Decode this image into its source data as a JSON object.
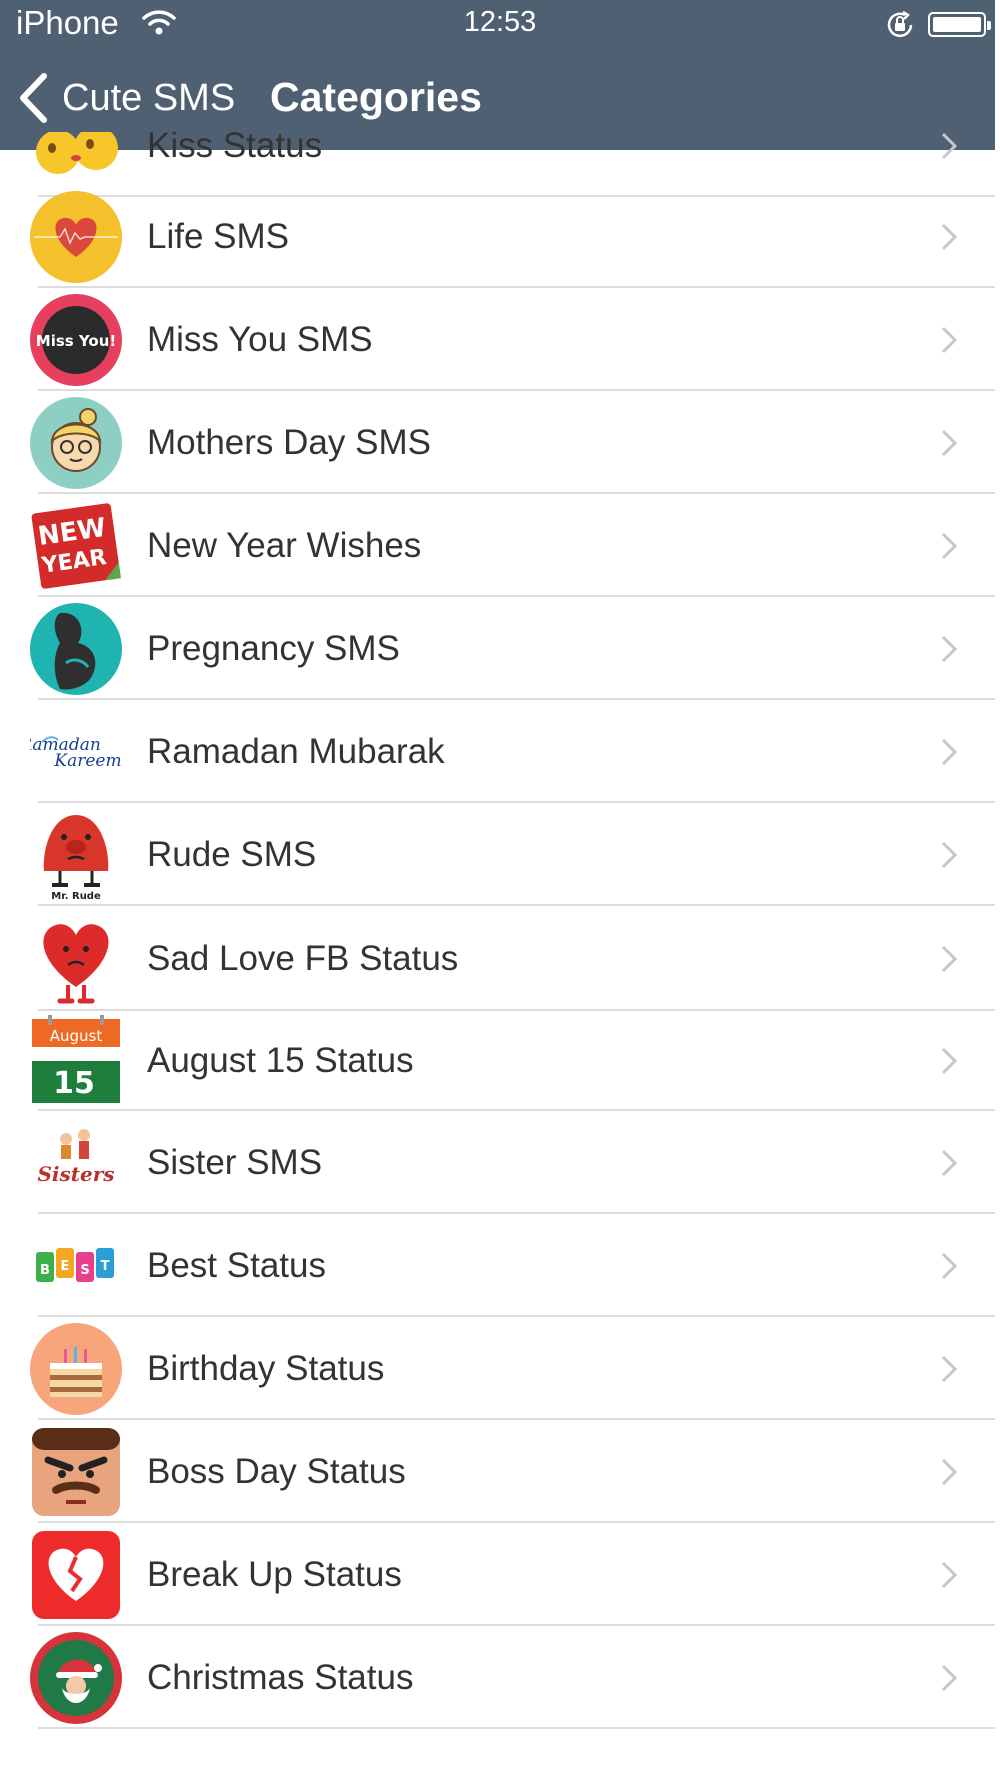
{
  "status_bar": {
    "carrier": "iPhone",
    "time": "12:53",
    "wifi_icon": "wifi-icon",
    "lock_icon": "rotation-lock-icon",
    "battery_icon": "battery-icon"
  },
  "nav": {
    "back_label": "Cute SMS",
    "title": "Categories",
    "bar_color": "#4f6073"
  },
  "categories": [
    {
      "label": "Kiss Status",
      "icon": "kiss-emoji-icon"
    },
    {
      "label": "Life SMS",
      "icon": "heartbeat-icon"
    },
    {
      "label": "Miss You SMS",
      "icon": "miss-you-icon"
    },
    {
      "label": "Mothers Day SMS",
      "icon": "mother-face-icon"
    },
    {
      "label": "New Year Wishes",
      "icon": "new-year-tag-icon"
    },
    {
      "label": "Pregnancy SMS",
      "icon": "pregnancy-icon"
    },
    {
      "label": "Ramadan Mubarak",
      "icon": "ramadan-kareem-icon"
    },
    {
      "label": "Rude SMS",
      "icon": "mr-rude-icon"
    },
    {
      "label": "Sad Love FB Status",
      "icon": "sad-heart-icon"
    },
    {
      "label": "August 15 Status",
      "icon": "august-15-calendar-icon"
    },
    {
      "label": "Sister SMS",
      "icon": "sisters-icon"
    },
    {
      "label": "Best Status",
      "icon": "best-tags-icon"
    },
    {
      "label": "Birthday Status",
      "icon": "birthday-cake-icon"
    },
    {
      "label": "Boss Day Status",
      "icon": "angry-boss-icon"
    },
    {
      "label": "Break Up Status",
      "icon": "broken-heart-icon"
    },
    {
      "label": "Christmas Status",
      "icon": "santa-icon"
    }
  ],
  "icon_text": {
    "miss_you": "Miss You!",
    "new_year_1": "NEW",
    "new_year_2": "YEAR",
    "ramadan_1": "Ramadan",
    "ramadan_2": "Kareem",
    "mr_rude": "Mr. Rude",
    "august": "August",
    "day_15": "15",
    "sisters": "Sisters",
    "best": [
      "B",
      "E",
      "S",
      "T"
    ]
  }
}
